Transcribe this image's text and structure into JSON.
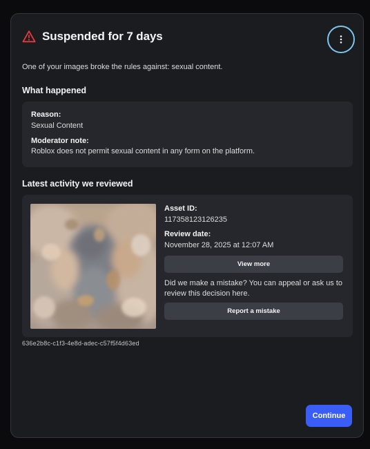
{
  "modal": {
    "title": "Suspended for 7 days",
    "subtitle": "One of your images broke the rules against: sexual content.",
    "warning_icon": "warning-triangle-icon",
    "menu_icon": "more-vertical-icon",
    "colors": {
      "warning": "#e53b3b",
      "accent": "#3a5df7",
      "focus_ring": "#7cc6f0"
    }
  },
  "what_happened": {
    "heading": "What happened",
    "reason_label": "Reason:",
    "reason_value": "Sexual Content",
    "moderator_note_label": "Moderator note:",
    "moderator_note_value": "Roblox does not permit sexual content in any form on the platform."
  },
  "latest_activity": {
    "heading": "Latest activity we reviewed",
    "asset_id_label": "Asset ID:",
    "asset_id_value": "117358123126235",
    "review_date_label": "Review date:",
    "review_date_value": "November 28, 2025 at 12:07 AM",
    "view_more_label": "View more",
    "mistake_message": "Did we make a mistake? You can appeal or ask us to review this decision here.",
    "report_mistake_label": "Report a mistake",
    "guid": "636e2b8c-c1f3-4e8d-adec-c57f5f4d63ed"
  },
  "footer": {
    "continue_label": "Continue"
  }
}
